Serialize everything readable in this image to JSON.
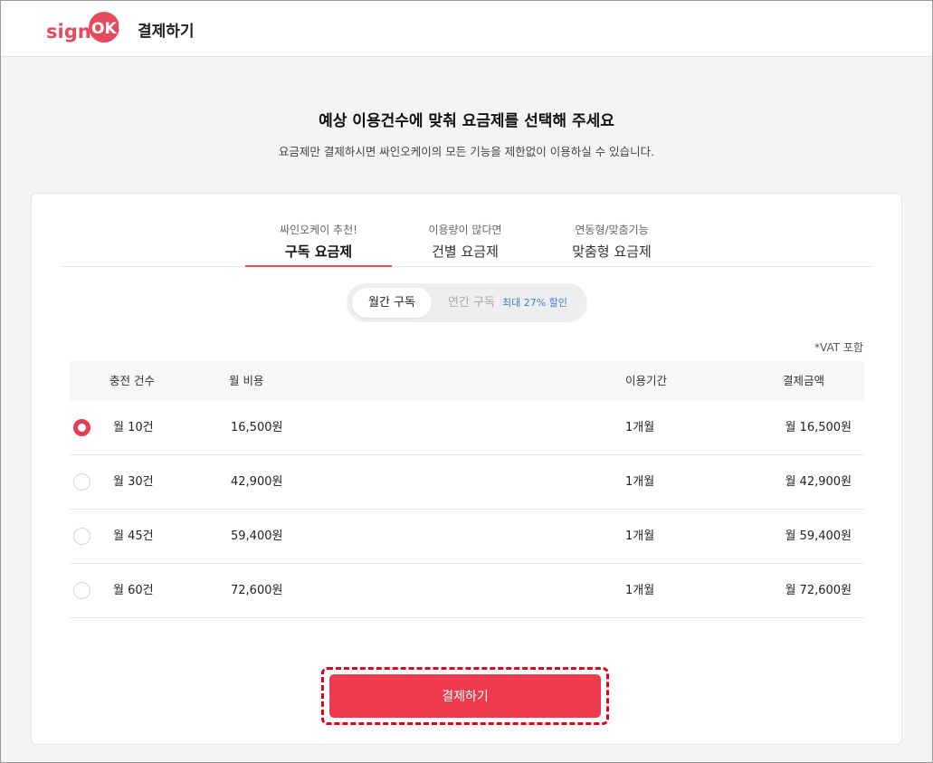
{
  "header": {
    "logo_text": "signOK!",
    "title": "결제하기"
  },
  "intro": {
    "headline": "예상 이용건수에 맞춰 요금제를 선택해 주세요",
    "subline": "요금제만 결제하시면 싸인오케이의 모든 기능을 제한없이 이용하실 수 있습니다."
  },
  "plan_tabs": [
    {
      "small": "싸인오케이 추천!",
      "main": "구독 요금제",
      "active": true
    },
    {
      "small": "이용량이 많다면",
      "main": "건별 요금제",
      "active": false
    },
    {
      "small": "연동형/맞춤기능",
      "main": "맞춤형 요금제",
      "active": false
    }
  ],
  "period": {
    "monthly": "월간 구독",
    "yearly": "연간 구독",
    "yearly_badge": "최대 27% 할인"
  },
  "vat_note": "*VAT 포함",
  "table": {
    "headers": [
      "충전 건수",
      "월 비용",
      "이용기간",
      "결제금액"
    ],
    "rows": [
      {
        "count": "월 10건",
        "monthly_cost": "16,500원",
        "period": "1개월",
        "amount": "월 16,500원",
        "selected": true
      },
      {
        "count": "월 30건",
        "monthly_cost": "42,900원",
        "period": "1개월",
        "amount": "월 42,900원",
        "selected": false
      },
      {
        "count": "월 45건",
        "monthly_cost": "59,400원",
        "period": "1개월",
        "amount": "월 59,400원",
        "selected": false
      },
      {
        "count": "월 60건",
        "monthly_cost": "72,600원",
        "period": "1개월",
        "amount": "월 72,600원",
        "selected": false
      }
    ]
  },
  "pay_button": "결제하기",
  "colors": {
    "accent": "#ee3a4f",
    "highlight_outline": "#e0001b",
    "badge_blue": "#3b82d9"
  }
}
